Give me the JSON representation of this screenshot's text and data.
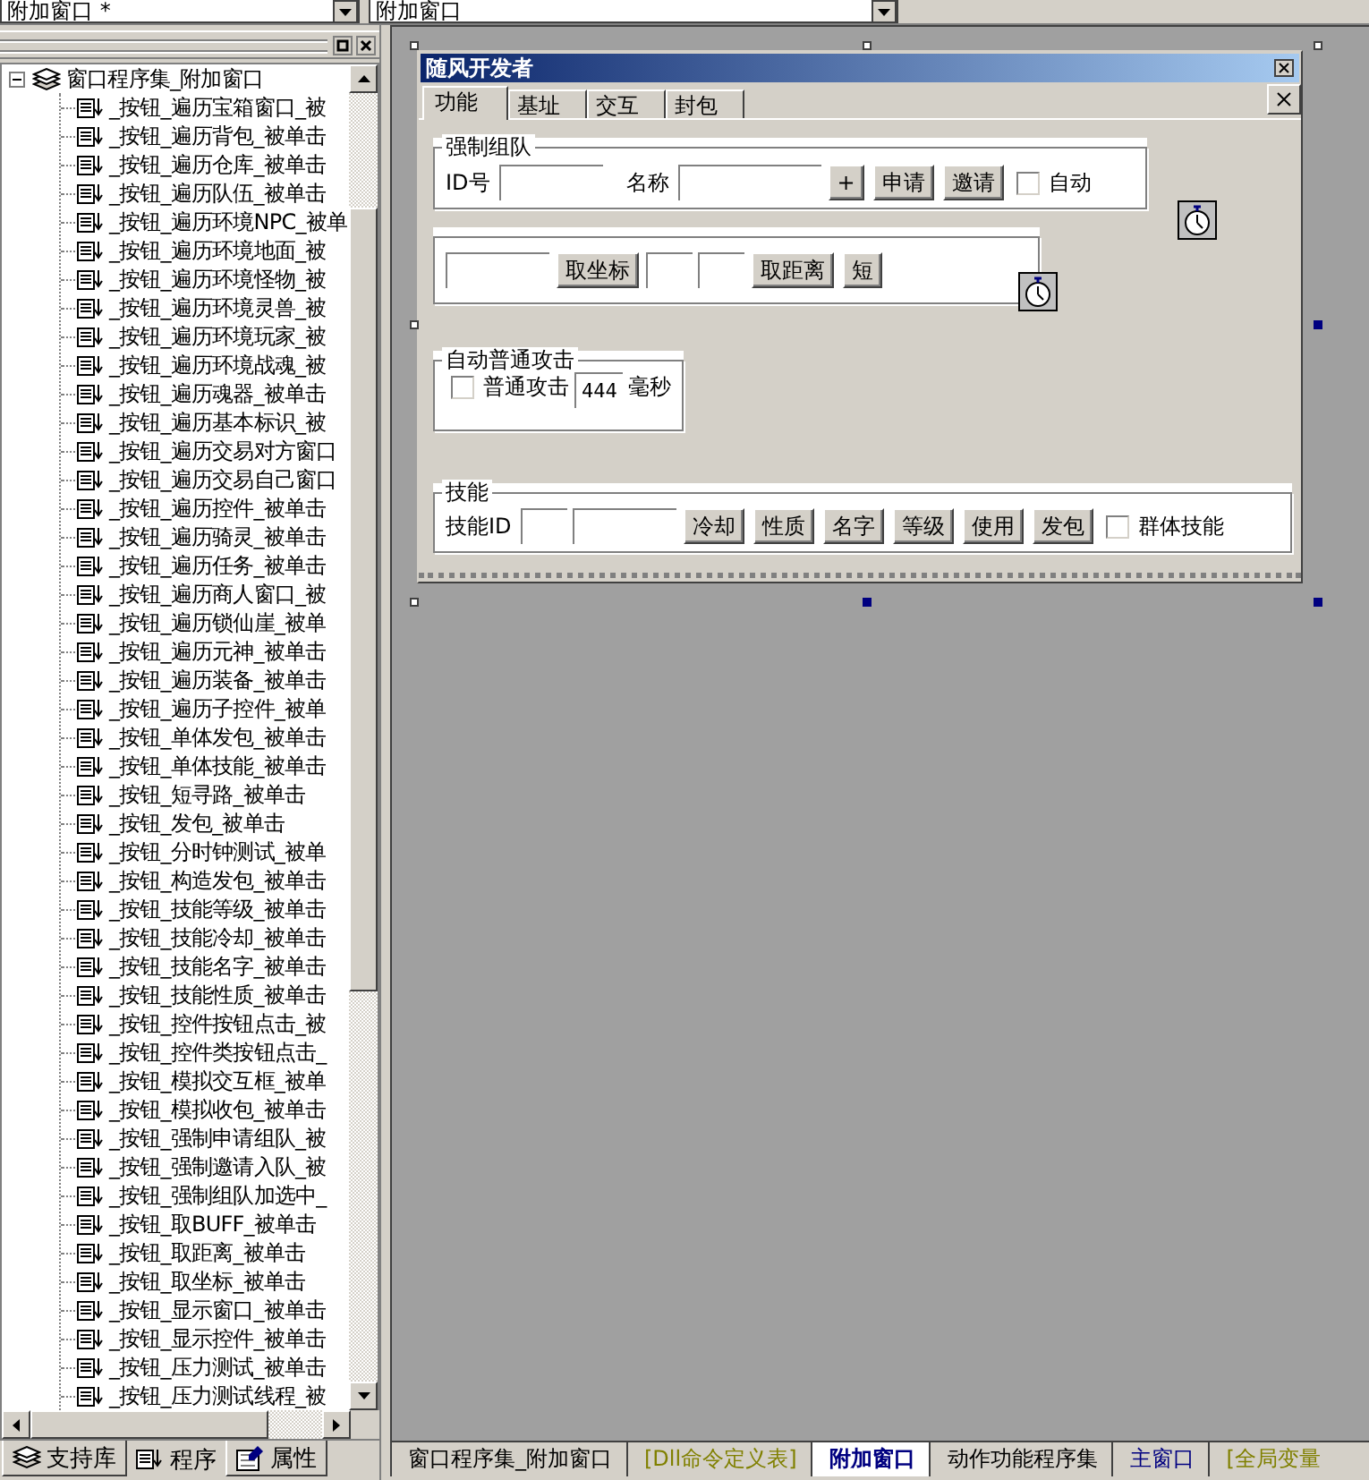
{
  "top_bar": {
    "left_combo": "附加窗口 *",
    "right_combo": "附加窗口"
  },
  "tree": {
    "root": {
      "label": "窗口程序集_附加窗口",
      "expanded": true,
      "children": [
        {
          "label": "_按钮_遍历宝箱窗口_被"
        },
        {
          "label": "_按钮_遍历背包_被单击"
        },
        {
          "label": "_按钮_遍历仓库_被单击"
        },
        {
          "label": "_按钮_遍历队伍_被单击"
        },
        {
          "label": "_按钮_遍历环境NPC_被单"
        },
        {
          "label": "_按钮_遍历环境地面_被"
        },
        {
          "label": "_按钮_遍历环境怪物_被"
        },
        {
          "label": "_按钮_遍历环境灵兽_被"
        },
        {
          "label": "_按钮_遍历环境玩家_被"
        },
        {
          "label": "_按钮_遍历环境战魂_被"
        },
        {
          "label": "_按钮_遍历魂器_被单击"
        },
        {
          "label": "_按钮_遍历基本标识_被"
        },
        {
          "label": "_按钮_遍历交易对方窗口"
        },
        {
          "label": "_按钮_遍历交易自己窗口"
        },
        {
          "label": "_按钮_遍历控件_被单击"
        },
        {
          "label": "_按钮_遍历骑灵_被单击"
        },
        {
          "label": "_按钮_遍历任务_被单击"
        },
        {
          "label": "_按钮_遍历商人窗口_被"
        },
        {
          "label": "_按钮_遍历锁仙崖_被单"
        },
        {
          "label": "_按钮_遍历元神_被单击"
        },
        {
          "label": "_按钮_遍历装备_被单击"
        },
        {
          "label": "_按钮_遍历子控件_被单"
        },
        {
          "label": "_按钮_单体发包_被单击"
        },
        {
          "label": "_按钮_单体技能_被单击"
        },
        {
          "label": "_按钮_短寻路_被单击"
        },
        {
          "label": "_按钮_发包_被单击"
        },
        {
          "label": "_按钮_分时钟测试_被单"
        },
        {
          "label": "_按钮_构造发包_被单击"
        },
        {
          "label": "_按钮_技能等级_被单击"
        },
        {
          "label": "_按钮_技能冷却_被单击"
        },
        {
          "label": "_按钮_技能名字_被单击"
        },
        {
          "label": "_按钮_技能性质_被单击"
        },
        {
          "label": "_按钮_控件按钮点击_被"
        },
        {
          "label": "_按钮_控件类按钮点击_"
        },
        {
          "label": "_按钮_模拟交互框_被单"
        },
        {
          "label": "_按钮_模拟收包_被单击"
        },
        {
          "label": "_按钮_强制申请组队_被"
        },
        {
          "label": "_按钮_强制邀请入队_被"
        },
        {
          "label": "_按钮_强制组队加选中_"
        },
        {
          "label": "_按钮_取BUFF_被单击"
        },
        {
          "label": "_按钮_取距离_被单击"
        },
        {
          "label": "_按钮_取坐标_被单击"
        },
        {
          "label": "_按钮_显示窗口_被单击"
        },
        {
          "label": "_按钮_显示控件_被单击"
        },
        {
          "label": "_按钮_压力测试_被单击"
        },
        {
          "label": "_按钮_压力测试线程_被"
        }
      ]
    }
  },
  "panel_tabs": [
    {
      "label": "支持库",
      "kind": "library",
      "selected": false
    },
    {
      "label": "程序",
      "kind": "program",
      "selected": true
    },
    {
      "label": "属性",
      "kind": "properties",
      "selected": false
    }
  ],
  "form": {
    "title": "随风开发者",
    "tabs": [
      {
        "label": "功能",
        "selected": true
      },
      {
        "label": "基址",
        "selected": false
      },
      {
        "label": "交互",
        "selected": false
      },
      {
        "label": "封包",
        "selected": false
      }
    ],
    "groups": [
      {
        "title": "强制组队",
        "items": [
          {
            "kind": "label",
            "text": "ID号"
          },
          {
            "kind": "field"
          },
          {
            "kind": "label",
            "text": "名称"
          },
          {
            "kind": "field_wide"
          },
          {
            "kind": "button",
            "text": "+"
          },
          {
            "kind": "button",
            "text": "申请"
          },
          {
            "kind": "button",
            "text": "邀请"
          },
          {
            "kind": "checkbox",
            "text": "自动",
            "checked": false
          }
        ]
      },
      {
        "items": [
          {
            "kind": "field"
          },
          {
            "kind": "button",
            "text": "取坐标"
          },
          {
            "kind": "field_narrow"
          },
          {
            "kind": "field_narrow"
          },
          {
            "kind": "button",
            "text": "取距离"
          },
          {
            "kind": "button",
            "text": "短"
          }
        ]
      },
      {
        "title": "自动普通攻击",
        "items": [
          {
            "kind": "checkbox",
            "text": "普通攻击",
            "checked": false
          },
          {
            "kind": "field_value",
            "value": "444"
          },
          {
            "kind": "label",
            "text": "毫秒"
          }
        ]
      },
      {
        "title": "技能",
        "items": [
          {
            "kind": "label",
            "text": "技能ID"
          },
          {
            "kind": "field_narrow"
          },
          {
            "kind": "field"
          },
          {
            "kind": "button",
            "text": "冷却"
          },
          {
            "kind": "button",
            "text": "性质"
          },
          {
            "kind": "button",
            "text": "名字"
          },
          {
            "kind": "button",
            "text": "等级"
          },
          {
            "kind": "button",
            "text": "使用"
          },
          {
            "kind": "button",
            "text": "发包"
          },
          {
            "kind": "checkbox",
            "text": "群体技能",
            "checked": false
          }
        ]
      }
    ]
  },
  "editor_tabs": [
    {
      "label": "窗口程序集_附加窗口",
      "selected": false,
      "color": "#000000"
    },
    {
      "label": "[Dll命令定义表]",
      "selected": false,
      "color": "#808000"
    },
    {
      "label": "附加窗口",
      "selected": true,
      "color": "#000080"
    },
    {
      "label": "动作功能程序集",
      "selected": false,
      "color": "#000000"
    },
    {
      "label": "主窗口",
      "selected": false,
      "color": "#000080"
    },
    {
      "label": "[全局变量",
      "selected": false,
      "color": "#808000"
    }
  ]
}
